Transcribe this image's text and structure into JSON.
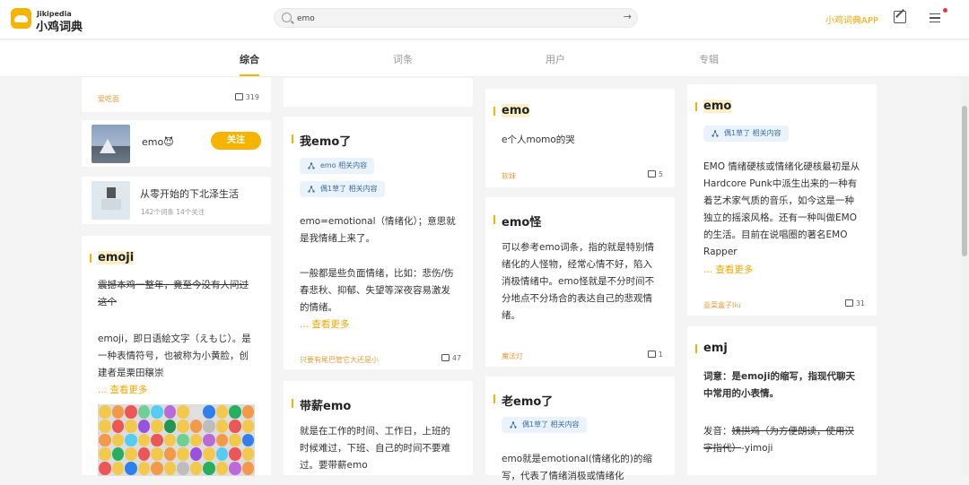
{
  "brand": {
    "en": "Jikipedia",
    "cn": "小鸡词典"
  },
  "search": {
    "value": "emo"
  },
  "header": {
    "app_link": "小鸡词典APP"
  },
  "tabs": [
    "综合",
    "词条",
    "用户",
    "专辑"
  ],
  "left": {
    "top_author": "爱吃面",
    "top_likes": "319",
    "user1": {
      "name": "emo😈",
      "follow": "关注"
    },
    "album": {
      "title": "从零开始的下北泽生活",
      "meta": "142个词条 14个关注"
    },
    "emoji_card": {
      "title": "emoji",
      "strike_text": "震撼本鸡一整年，竟至今没有人问过这个",
      "line1": "emoji，即日语絵文字（えもじ）。是一种表情符号，也被称为小黄脸，创建者是栗田穣崇",
      "more": "... 查看更多"
    }
  },
  "col2": {
    "card1": {
      "title": "我emo了",
      "tag1": "emo 相关内容",
      "tag2": "偶1草了 相关内容",
      "body": "emo=emotional（情绪化）；意思就是我情绪上来了。",
      "body2": "一般都是些负面情绪，比如：悲伤/伤春悲秋、抑郁、失望等深夜容易激发的情绪。",
      "more": "... 查看更多",
      "author": "只要有尾巴管它大还是小",
      "likes": "47"
    },
    "card2": {
      "title": "带薪emo",
      "body": "就是在工作的时间、工作日，上班的时候难过，下班、自己的时间不要难过。要带薪emo"
    }
  },
  "col3": {
    "card1": {
      "title": "emo",
      "body": "e个人momo的哭",
      "author": "软妹",
      "likes": "5"
    },
    "card2": {
      "title": "emo怪",
      "body": "可以参考emo词条，指的就是特别情绪化的人怪物，经常心情不好，陷入消极情绪中。emo怪就是不分时间不分地点不分场合的表达自己的悲观情绪。",
      "author": "魔法灯",
      "likes": "1"
    },
    "card3": {
      "title": "老emo了",
      "tag": "偶1草了 相关内容",
      "body": "emo就是emotional(情绪化的)的缩写，代表了情绪消极或情绪化"
    }
  },
  "col4": {
    "card1": {
      "title": "emo",
      "tag": "偶1草了 相关内容",
      "body": "EMO 情绪硬核或情绪化硬核最初是从Hardcore Punk中派生出来的一种有着艺术家气质的音乐，如今这是一种独立的摇滚风格。还有一种叫做EMO的生活。目前在说唱圈的著名EMO Rapper",
      "more": "... 查看更多",
      "author": "韭菜盒子liu",
      "likes": "31"
    },
    "card2": {
      "title": "emj",
      "body1": "词意：是emoji的缩写，指现代聊天中常用的小表情。",
      "body2_strike": "姨拱鸡（为方便朗读，使用汉字指代）",
      "body2": "发音：",
      "body2_after": "-yimoji"
    }
  }
}
